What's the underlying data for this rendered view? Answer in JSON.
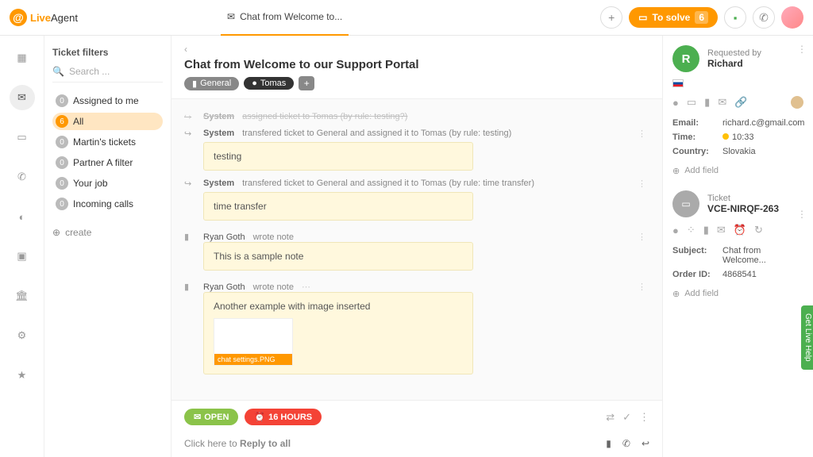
{
  "header": {
    "logo_live": "Live",
    "logo_agent": "Agent",
    "tab_title": "Chat from Welcome to...",
    "solve_label": "To solve",
    "solve_count": "6"
  },
  "filters": {
    "title": "Ticket filters",
    "search_placeholder": "Search ...",
    "items": [
      {
        "count": "0",
        "label": "Assigned to me"
      },
      {
        "count": "6",
        "label": "All"
      },
      {
        "count": "0",
        "label": "Martin's tickets"
      },
      {
        "count": "0",
        "label": "Partner A filter"
      },
      {
        "count": "0",
        "label": "Your job"
      },
      {
        "count": "0",
        "label": "Incoming calls"
      }
    ],
    "create": "create"
  },
  "ticket": {
    "title": "Chat from Welcome to our Support Portal",
    "tag_general": "General",
    "tag_assignee": "Tomas"
  },
  "thread": [
    {
      "type": "sys",
      "actor": "System",
      "text": "assigned ticket to Tomas (by rule: testing?)"
    },
    {
      "type": "sys",
      "actor": "System",
      "text": "transfered ticket to General and assigned it to Tomas (by rule: testing)",
      "note": "testing"
    },
    {
      "type": "sys",
      "actor": "System",
      "text": "transfered ticket to General and assigned it to Tomas (by rule: time transfer)",
      "note": "time transfer"
    },
    {
      "type": "note",
      "actor": "Ryan Goth",
      "meta": "wrote note",
      "note": "This is a sample note"
    },
    {
      "type": "imgnote",
      "actor": "Ryan Goth",
      "meta": "wrote note",
      "note": "Another example with image inserted",
      "img_label": "chat settings.PNG"
    }
  ],
  "reply": {
    "open": "OPEN",
    "hours": "16 HOURS",
    "placeholder_prefix": "Click here to ",
    "placeholder_bold": "Reply to all"
  },
  "right": {
    "req_initial": "R",
    "req_label": "Requested by",
    "req_name": "Richard",
    "email_label": "Email:",
    "email_val": "richard.c@gmail.com",
    "time_label": "Time:",
    "time_val": "10:33",
    "country_label": "Country:",
    "country_val": "Slovakia",
    "add_field": "Add field",
    "ticket_label": "Ticket",
    "ticket_id": "VCE-NIRQF-263",
    "subject_label": "Subject:",
    "subject_val": "Chat from Welcome...",
    "order_label": "Order ID:",
    "order_val": "4868541",
    "live_help": "Get Live Help"
  }
}
